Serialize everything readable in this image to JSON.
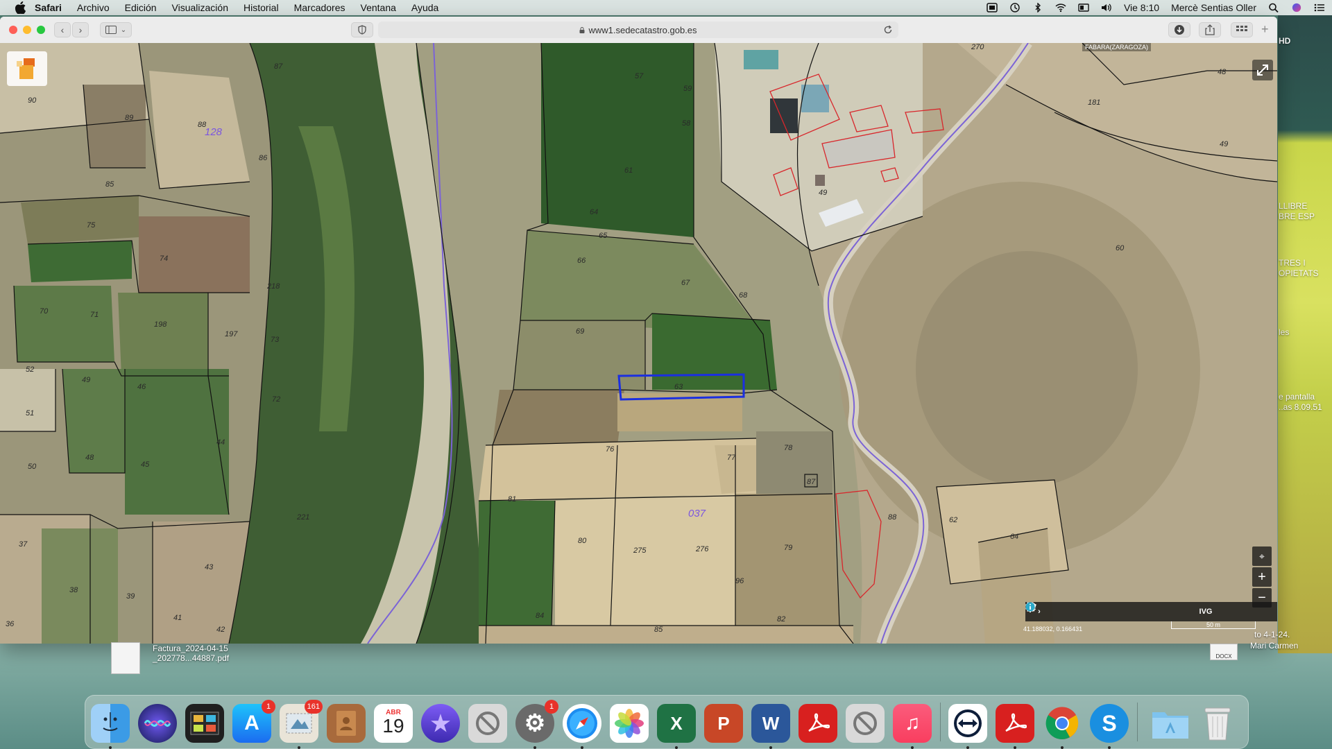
{
  "menubar": {
    "app_name": "Safari",
    "items": [
      "Archivo",
      "Edición",
      "Visualización",
      "Historial",
      "Marcadores",
      "Ventana",
      "Ayuda"
    ],
    "clock": "Vie 8:10",
    "user": "Mercè Sentias Oller",
    "tray_icons": [
      "screen-mirror-icon",
      "time-machine-icon",
      "bluetooth-icon",
      "wifi-icon",
      "display-icon",
      "volume-icon",
      "search-icon",
      "siri-icon",
      "control-icon"
    ]
  },
  "browser": {
    "url": "www1.sedecatastro.gob.es"
  },
  "map": {
    "municipality": "FABARA(ZARAGOZA)",
    "coordinates": "41.188032, 0.166431",
    "scale_label": "50 m",
    "zone_labels": [
      "128",
      "037"
    ],
    "parcel_labels": [
      "90",
      "89",
      "88",
      "87",
      "86",
      "85",
      "75",
      "74",
      "70",
      "71",
      "198",
      "197",
      "218",
      "73",
      "52",
      "49",
      "46",
      "51",
      "50",
      "48",
      "45",
      "44",
      "72",
      "37",
      "38",
      "39",
      "43",
      "41",
      "42",
      "36",
      "221",
      "57",
      "59",
      "61",
      "64",
      "65",
      "66",
      "67",
      "68",
      "69",
      "63",
      "76",
      "77",
      "78",
      "81",
      "80",
      "275",
      "276",
      "79",
      "84",
      "85",
      "82",
      "87",
      "96",
      "58",
      "49",
      "270",
      "48",
      "181",
      "60",
      "49",
      "62",
      "64",
      "88"
    ],
    "toolbar_labels": [
      "IVG"
    ]
  },
  "desktop": {
    "file_name_line1": "Factura_2024-04-15",
    "file_name_line2": "_202778...44887.pdf",
    "docx_badge": "DOCX",
    "docx_caption_line1": "to 4-1-24.",
    "docx_caption_line2": "Mari Carmen",
    "side_snippets": [
      "LLIBRE",
      "BRE ESP",
      "TRES I",
      "OPIETATS",
      "les",
      "e pantalla",
      "..as 8.09.51",
      "HD"
    ]
  },
  "dock": {
    "calendar_month": "ABR",
    "calendar_day": "19",
    "badges": {
      "app_store": "1",
      "mail": "161",
      "system_prefs": "1"
    },
    "colors": {
      "finder": "#3b9be6",
      "app_store": "#1b86f0",
      "excel": "#1f7244",
      "powerpoint": "#c84727",
      "word": "#2b579a",
      "acrobat": "#d8201f",
      "chrome": "#ffffff",
      "skype": "#1a8fe0"
    }
  }
}
